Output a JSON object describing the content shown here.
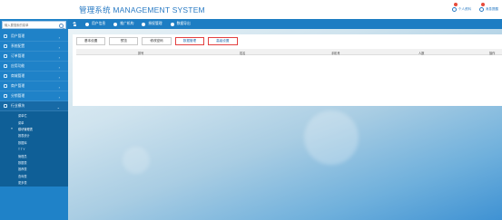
{
  "header": {
    "title": "管理系统 MANAGEMENT SYSTEM",
    "links": [
      {
        "label": "个人资料",
        "icon": "user-icon"
      },
      {
        "label": "消息提醒",
        "icon": "bell-icon"
      }
    ]
  },
  "sidebar": {
    "search_placeholder": "输入要搜索的菜单",
    "menu": [
      {
        "label": "用户管理",
        "icon": "user-icon"
      },
      {
        "label": "系统配置",
        "icon": "settings-icon"
      },
      {
        "label": "订单管理",
        "icon": "order-icon"
      },
      {
        "label": "应用功能",
        "icon": "app-icon"
      },
      {
        "label": "商城管理",
        "icon": "shop-icon"
      },
      {
        "label": "商户管理",
        "icon": "merchant-icon"
      },
      {
        "label": "分销管理",
        "icon": "share-icon"
      },
      {
        "label": "行业模块",
        "icon": "module-icon"
      }
    ],
    "submenu": [
      "菜单栏",
      "菜单",
      "模块管理表",
      "报表统计",
      "数据库",
      "T T Y",
      "管理员",
      "数据表",
      "推荐表",
      "查询表",
      "更多表"
    ],
    "submenu_current": 2
  },
  "navbar": {
    "items": [
      "用户信息",
      "推广机构",
      "授权管理",
      "数据导出"
    ]
  },
  "panel": {
    "buttons": [
      "基本设置",
      "预览",
      "修改密码",
      "数据管理",
      "高级设置"
    ],
    "highlighted": [
      3,
      4
    ],
    "columns": [
      "排号",
      "姓名",
      "手机号",
      "人数",
      "操作"
    ]
  },
  "colors": {
    "sidebar": "#1f82c8",
    "navbar": "#1d7dc3",
    "accent": "#2a7bc4",
    "highlight_border": "#e34040"
  }
}
